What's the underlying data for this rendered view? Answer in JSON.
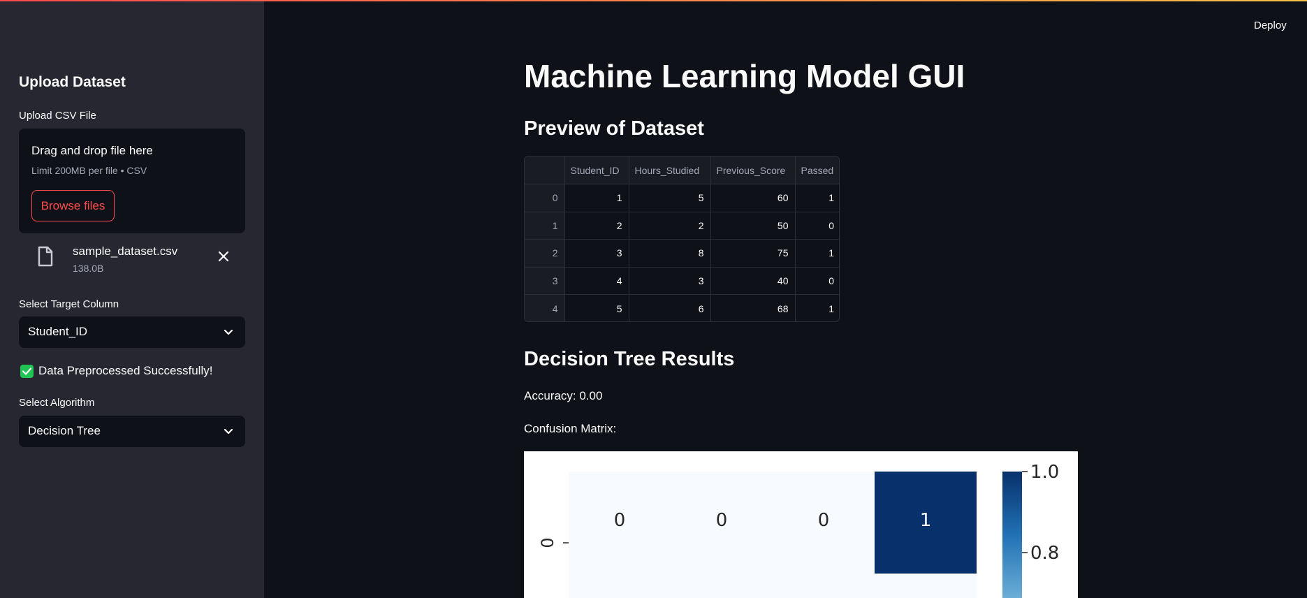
{
  "sidebar": {
    "title": "Upload Dataset",
    "upload_label": "Upload CSV File",
    "dropzone": {
      "title": "Drag and drop file here",
      "limit": "Limit 200MB per file • CSV",
      "browse_label": "Browse files"
    },
    "file": {
      "name": "sample_dataset.csv",
      "size": "138.0B"
    },
    "target_label": "Select Target Column",
    "target_value": "Student_ID",
    "preprocess_label": "Data Preprocessed Successfully!",
    "algorithm_label": "Select Algorithm",
    "algorithm_value": "Decision Tree"
  },
  "header": {
    "deploy_label": "Deploy"
  },
  "main": {
    "title": "Machine Learning Model GUI",
    "preview_heading": "Preview of Dataset",
    "table": {
      "columns": [
        "",
        "Student_ID",
        "Hours_Studied",
        "Previous_Score",
        "Passed"
      ],
      "rows": [
        [
          "0",
          "1",
          "5",
          "60",
          "1"
        ],
        [
          "1",
          "2",
          "2",
          "50",
          "0"
        ],
        [
          "2",
          "3",
          "8",
          "75",
          "1"
        ],
        [
          "3",
          "4",
          "3",
          "40",
          "0"
        ],
        [
          "4",
          "5",
          "6",
          "68",
          "1"
        ]
      ]
    },
    "results_heading": "Decision Tree Results",
    "accuracy_text": "Accuracy: 0.00",
    "confusion_label": "Confusion Matrix:"
  },
  "colors": {
    "accent": "#ff4b4b",
    "success": "#21c354",
    "background": "#0e1117",
    "sidebar": "#262730",
    "heatmap_high": "#08306b",
    "heatmap_low": "#f7fbff"
  },
  "chart_data": {
    "type": "heatmap",
    "row_labels": [
      "0"
    ],
    "values": [
      [
        0,
        0,
        0,
        1
      ]
    ],
    "colorbar_ticks": [
      "1.0",
      "0.8"
    ],
    "colormap": "Blues"
  }
}
